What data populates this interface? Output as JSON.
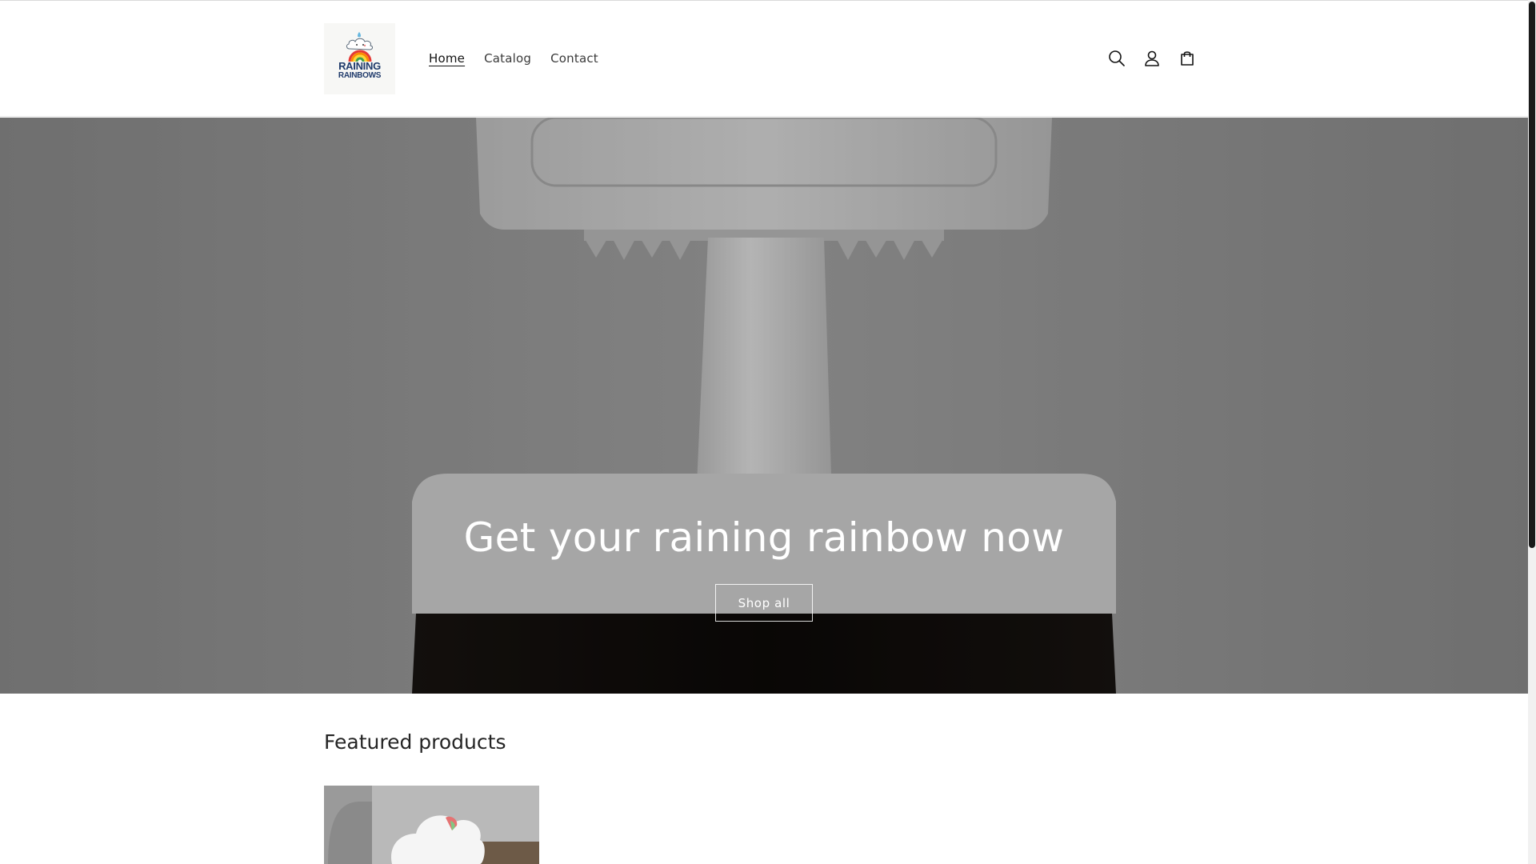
{
  "header": {
    "logo": {
      "line1": "RAINING",
      "line2": "RAINBOWS"
    },
    "nav": [
      {
        "label": "Home",
        "active": true
      },
      {
        "label": "Catalog",
        "active": false
      },
      {
        "label": "Contact",
        "active": false
      }
    ],
    "icons": [
      "search-icon",
      "account-icon",
      "cart-icon"
    ]
  },
  "hero": {
    "title": "Get your raining rainbow now",
    "button_label": "Shop all"
  },
  "featured": {
    "title": "Featured products"
  },
  "colors": {
    "text": "#121212",
    "hero_overlay": "#000000",
    "logo_text": "#1f3a6b"
  }
}
